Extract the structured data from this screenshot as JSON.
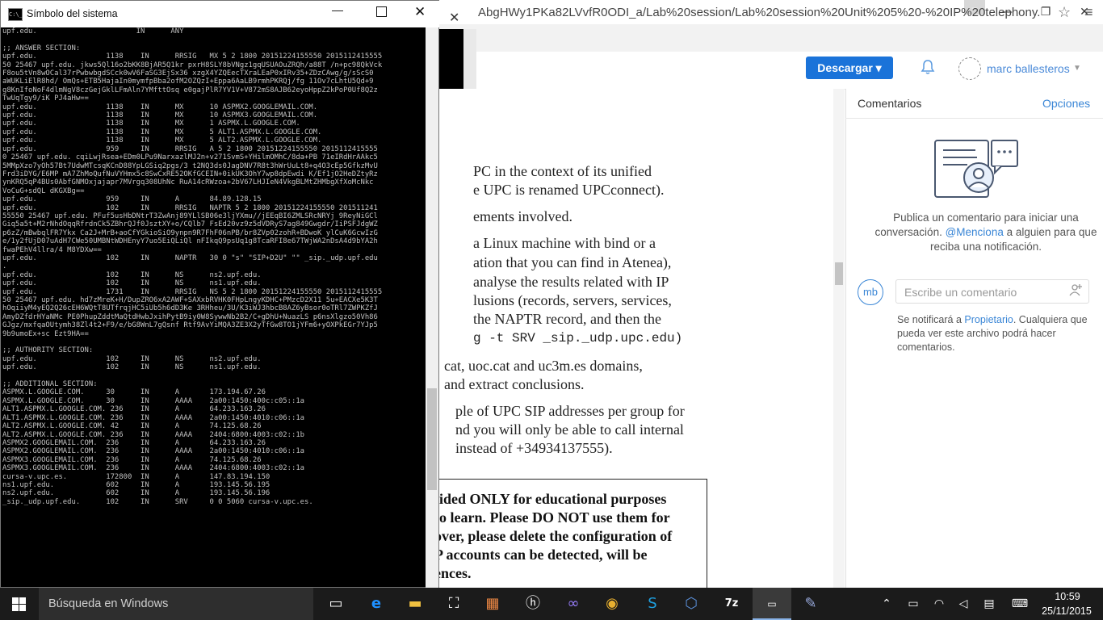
{
  "browser": {
    "url": "AbgHWy1PKa82LVvfR0ODI_a/Lab%20session/Lab%20session%20Unit%205%20-%20IP%20telephony.",
    "tab_count_glyph": "–",
    "controls": {
      "minimize": "—",
      "restore": "❐",
      "close": "✕"
    }
  },
  "app_header": {
    "download_label": "Descargar ▾",
    "user_name": "marc ballesteros",
    "user_chevron": "▼"
  },
  "viewer": {
    "close_glyph": "✕"
  },
  "document": {
    "lines": [
      "PC in the context of its unified",
      "e UPC is renamed UPCconnect).",
      "ements involved.",
      "a Linux machine with bind or a",
      "ation that you can find in Atenea),",
      "analyse the results related with IP",
      "lusions (records, servers, services,",
      "the NAPTR record, and then the",
      "g -t SRV _sip._udp.upc.edu)",
      "cat, uoc.cat and uc3m.es domains,",
      "and extract conclusions.",
      "ple of UPC SIP addresses per group for",
      "nd you will only be able to call internal",
      "instead of +34934137555)."
    ],
    "notice": [
      "ided ONLY for educational purposes",
      "to learn. Please DO NOT use them for",
      "over, please delete the configuration of",
      "P accounts can be detected, will be",
      "ences."
    ]
  },
  "comments": {
    "title": "Comentarios",
    "options": "Opciones",
    "empty_part1": "Publica un comentario para iniciar una conversación.",
    "mention": "@Menciona",
    "empty_part2": "a alguien para que reciba una notificación.",
    "avatar_initials": "mb",
    "input_placeholder": "Escribe un comentario",
    "notify_part1": "Se notificará a",
    "owner": "Propietario",
    "notify_part2": ". Cualquiera que pueda ver este archivo podrá hacer comentarios."
  },
  "cmd": {
    "title": "Símbolo del sistema",
    "icon_text": "C:\\_",
    "controls": {
      "minimize": "—",
      "close": "✕"
    },
    "output": "upf.edu.                       IN      ANY\n\n;; ANSWER SECTION:\nupf.edu.                1138    IN      RRSIG   MX 5 2 1800 20151224155550 2015112415555\n50 25467 upf.edu. jkws5Ql16o2bKK8BjAR5Q1kr pxrH8SLY8bVNgz1gqUSUAOuZRQh/a88T /n+pc98QkVck\nF8ou5tVn8wOCal37rPwbwbgdSCck0wV6FaSG3EjSx36 xzgX4YZQEecTXraLEaP0xIRv35+ZDzCAwg/g/sScS0\naWUKLiElR8hd/ OmQs+ETB5HajaIn0mymfpBba2ofM2OZQzI+Eppa6AaLB9rmhPKRQj/fg 11Ov7cLhtU5Qd+9\ng8KnIfoNoF4dlmNgV8czGejGklLFmAln7YMfttOsq e0gajPlR7YV1V+V872mS8AJB62eyoHppZ2kPoP0Uf8Q2z\nTwUqTgy9/iK PJ4aHw==\nupf.edu.                1138    IN      MX      10 ASPMX2.GOOGLEMAIL.COM.\nupf.edu.                1138    IN      MX      10 ASPMX3.GOOGLEMAIL.COM.\nupf.edu.                1138    IN      MX      1 ASPMX.L.GOOGLE.COM.\nupf.edu.                1138    IN      MX      5 ALT1.ASPMX.L.GOOGLE.COM.\nupf.edu.                1138    IN      MX      5 ALT2.ASPMX.L.GOOGLE.COM.\nupf.edu.                959     IN      RRSIG   A 5 2 1800 20151224155550 2015112415555\n0 25467 upf.edu. cqiLwjRsea+EDm0LPu9NarxazlMJ2n+v271SvmS+YHilmOMhC/8da+PB 71eIRdHrAAkc5\n5MMpXzo7yOh57Bt7UdwMTcsqKCnD88YpLGSiq2pgs/3 t2NQ3ds0JagDNV7R8t3hWrUuLt8+q4O3cEp5GfkzMvU\nFrd3iDYG/E6MP mA7ZhMoQufNuVYHmx5c8SwCxRE52OKfGCEIN+0ikUK3OhY7wp8dpEwdi K/Ef1jO2HeDZtyRz\nynKRQ5qP4BUs0AbfGNMOxjajapr7MVrgq308UhNc RuA14cRWzoa+2bV67LHJIeN4VkgBLMtZHMbgXfXoMcNkc\nVoCuG+sdQL dKGXBg==\nupf.edu.                959     IN      A       84.89.128.15\nupf.edu.                102     IN      RRSIG   NAPTR 5 2 1800 20151224155550 201511241\n55550 25467 upf.edu. PFuf5usHbDNtrT3ZwAnj89YLlSB06e3ljYXmu//jEEqBI6ZMLSRcNRYj 9ReyNiGCl\nGiq5a5t+M2rNhdOqqRfrdnCk5ZBhrQJf0JsztXY+o/CQlb7 FsEd20vz9z5dVDRyS7ag849Gwgdr/IiPSFJdgWZ\np6zZ/mBwbqlFR7Ykx Ca2J+MrB+aoCfYGkioSiO9ynpn9R7FhF06nPB/br8ZVp02zohR+BDwoK ylCuK6GcwIzG\ne/1y2fUjD07uAdH7CWe50UMBNtWDHEnyY7uo5EiQLiQl nFIkqQ9psUq1g8TcaRFI8e67TWjWA2nDsA4d9bYA2h\nfwaPEhV4llra/4 M8YDXw==\nupf.edu.                102     IN      NAPTR   30 0 \"s\" \"SIP+D2U\" \"\" _sip._udp.upf.edu\n.\nupf.edu.                102     IN      NS      ns2.upf.edu.\nupf.edu.                102     IN      NS      ns1.upf.edu.\nupf.edu.                1731    IN      RRSIG   NS 5 2 1800 20151224155550 2015112415555\n50 25467 upf.edu. hd7zMreK+H/DupZRO6xA2AWF+SAXxbRVHK0FHpLngyKDHC+PMzcD2X11 5u+EACXe5K3T\nhOqiiyM4yEQ2Q26cEH6WQtT8UTfrqjHC5iUb5h6dD3Ke 3RHheu/3U/K3iWJ3hbcB8AZ6yBsor0oTRl7ZWPKZfJ\nAmyDZfdrHYaNMc PE0PhupZddtMaQtdHwbJxihPytB9iy0W8SywwNb2B2/C+gDhU+NuazLS p6nsXlgzo50Vh86\nGJgz/mxfqaOUtymh38Zl4t2+F9/e/bG8WnL7gQsnf Rtf9AvYiMQA3ZE3X2yTfGw8TO1jYFm6+yOXPkEGr7YJp5\n9b9umoEx+sc Ezt9HA==\n\n;; AUTHORITY SECTION:\nupf.edu.                102     IN      NS      ns2.upf.edu.\nupf.edu.                102     IN      NS      ns1.upf.edu.\n\n;; ADDITIONAL SECTION:\nASPMX.L.GOOGLE.COM.     30      IN      A       173.194.67.26\nASPMX.L.GOOGLE.COM.     30      IN      AAAA    2a00:1450:400c:c05::1a\nALT1.ASPMX.L.GOOGLE.COM. 236    IN      A       64.233.163.26\nALT1.ASPMX.L.GOOGLE.COM. 236    IN      AAAA    2a00:1450:4010:c06::1a\nALT2.ASPMX.L.GOOGLE.COM. 42     IN      A       74.125.68.26\nALT2.ASPMX.L.GOOGLE.COM. 236    IN      AAAA    2404:6800:4003:c02::1b\nASPMX2.GOOGLEMAIL.COM.  236     IN      A       64.233.163.26\nASPMX2.GOOGLEMAIL.COM.  236     IN      AAAA    2a00:1450:4010:c06::1a\nASPMX3.GOOGLEMAIL.COM.  236     IN      A       74.125.68.26\nASPMX3.GOOGLEMAIL.COM.  236     IN      AAAA    2404:6800:4003:c02::1a\ncursa-v.upc.es.         172800  IN      A       147.83.194.150\nns1.upf.edu.            602     IN      A       193.145.56.195\nns2.upf.edu.            602     IN      A       193.145.56.196\n_sip._udp.upf.edu.      102     IN      SRV     0 0 5060 cursa-v.upc.es."
  },
  "taskbar": {
    "search_placeholder": "Búsqueda en Windows",
    "time": "10:59",
    "date": "25/11/2015"
  }
}
